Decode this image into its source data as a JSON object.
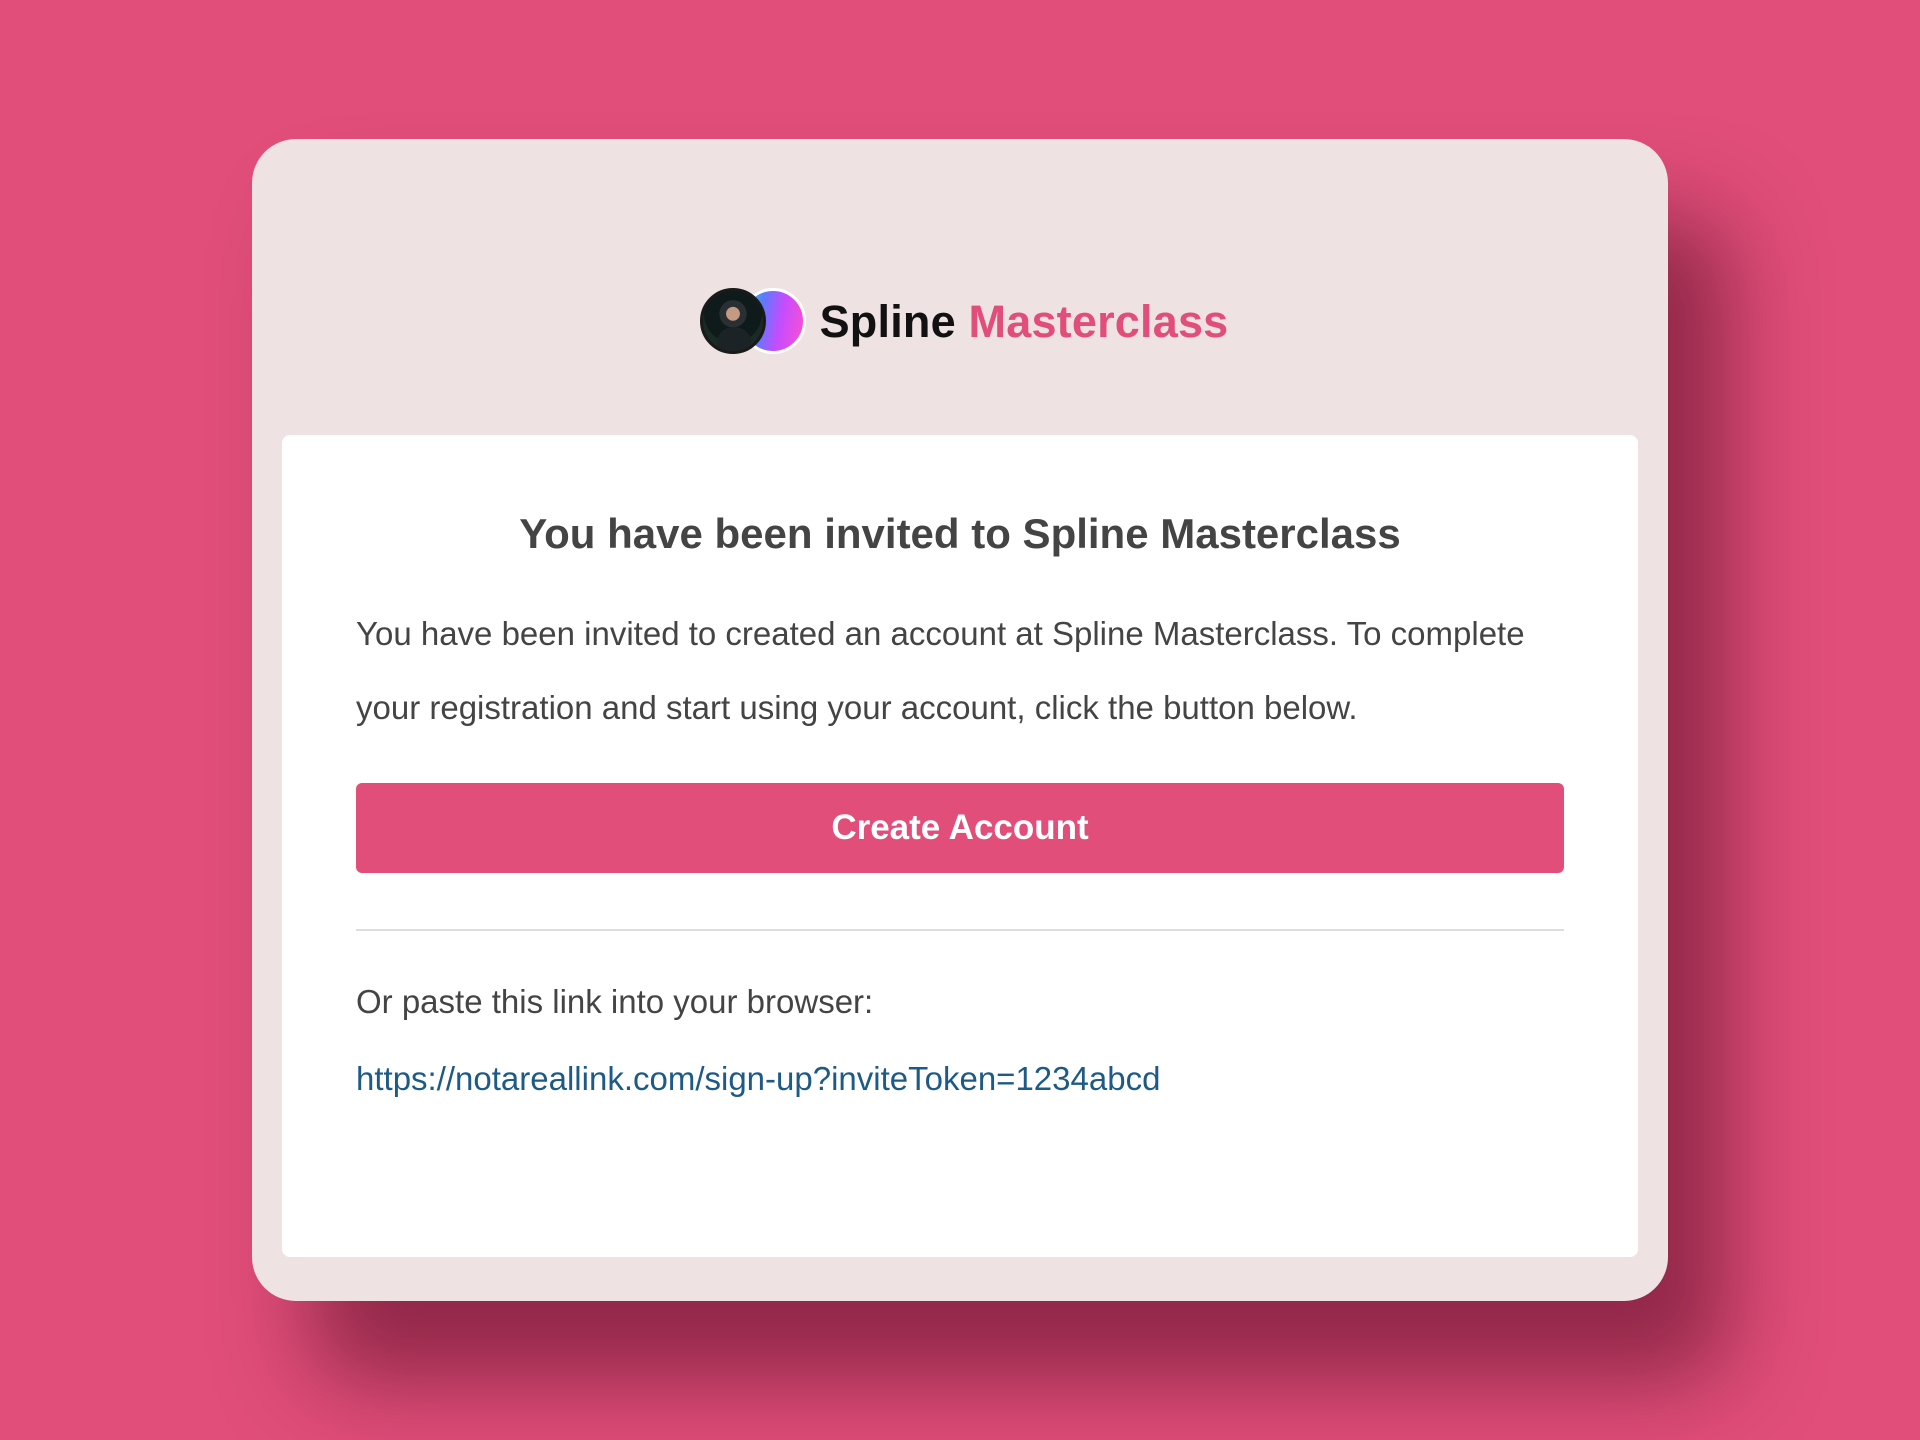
{
  "brand": {
    "name_part1": "Spline",
    "name_part2": "Masterclass",
    "icons": [
      "avatar-photo",
      "gradient-orb-icon"
    ]
  },
  "invite": {
    "heading": "You have been invited to Spline Masterclass",
    "body": "You have been invited to created an account at Spline Masterclass. To complete your registration and start using your account, click the button below.",
    "button_label": "Create Account",
    "paste_label": "Or paste this link into your browser:",
    "link_text": "https://notareallink.com/sign-up?inviteToken=1234abcd"
  },
  "colors": {
    "background": "#e04e79",
    "card": "#eee2e3",
    "accent": "#e04e79",
    "text": "#444444",
    "link": "#1d5a85"
  }
}
